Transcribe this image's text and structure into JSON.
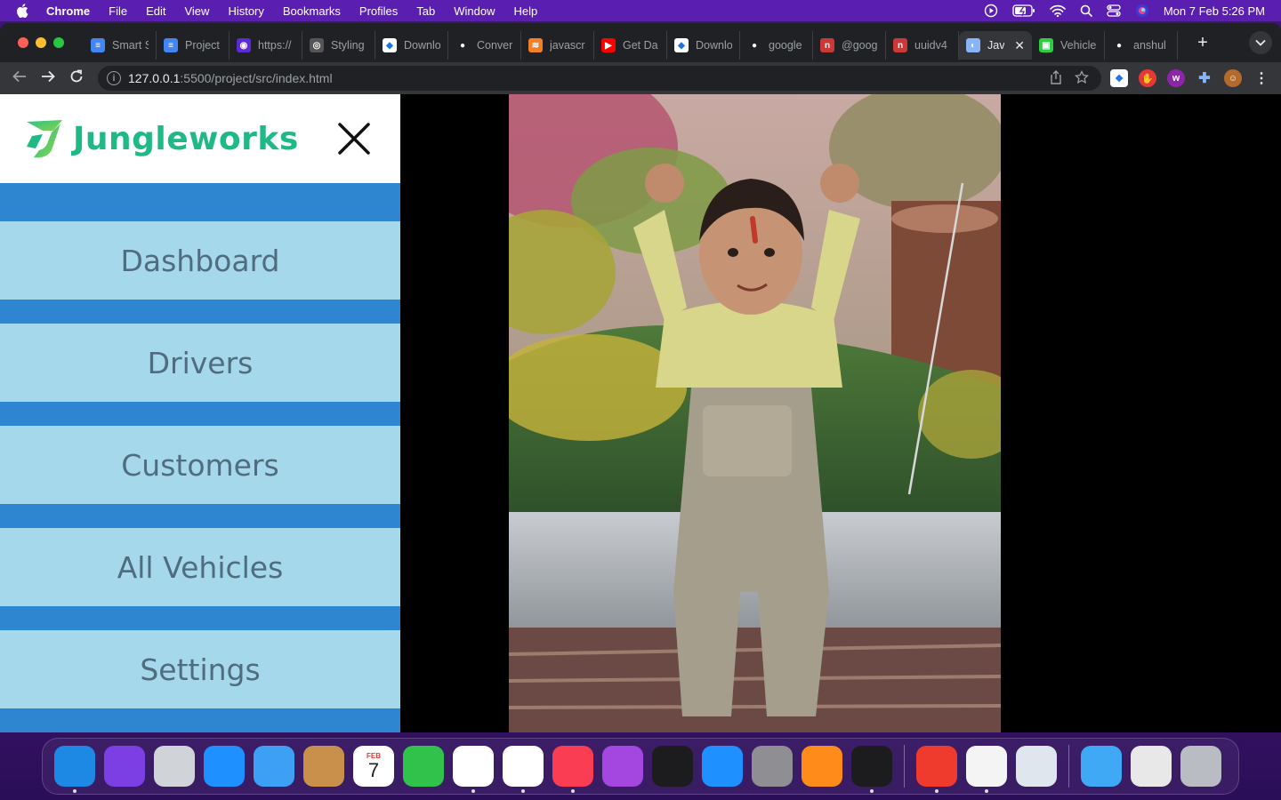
{
  "menubar": {
    "app": "Chrome",
    "items": [
      "File",
      "Edit",
      "View",
      "History",
      "Bookmarks",
      "Profiles",
      "Tab",
      "Window",
      "Help"
    ],
    "clock": "Mon 7 Feb  5:26 PM"
  },
  "tabs": [
    {
      "label": "Smart S",
      "color": "#4285f4",
      "glyph": "≡"
    },
    {
      "label": "Project",
      "color": "#4285f4",
      "glyph": "≡"
    },
    {
      "label": "https://",
      "color": "#5b2bd6",
      "glyph": "◉"
    },
    {
      "label": "Styling",
      "color": "#555555",
      "glyph": "◎"
    },
    {
      "label": "Downlo",
      "color": "#ffffff",
      "glyph": "◆"
    },
    {
      "label": "Conver",
      "color": "#202124",
      "glyph": "●"
    },
    {
      "label": "javascr",
      "color": "#f48024",
      "glyph": "≋"
    },
    {
      "label": "Get Da",
      "color": "#ff0000",
      "glyph": "▶"
    },
    {
      "label": "Downlo",
      "color": "#ffffff",
      "glyph": "◆"
    },
    {
      "label": "google",
      "color": "#202124",
      "glyph": "●"
    },
    {
      "label": "@goog",
      "color": "#cb3837",
      "glyph": "n"
    },
    {
      "label": "uuidv4",
      "color": "#cb3837",
      "glyph": "n"
    },
    {
      "label": "Jav",
      "color": "#8ab4f8",
      "glyph": "◐",
      "active": true
    },
    {
      "label": "Vehicle",
      "color": "#2ecc40",
      "glyph": "▣"
    },
    {
      "label": "anshul",
      "color": "#202124",
      "glyph": "●"
    }
  ],
  "address": {
    "host": "127.0.0.1",
    "path": ":5500/project/src/index.html"
  },
  "sidebar": {
    "brand": "Jungleworks",
    "items": [
      "Dashboard",
      "Drivers",
      "Customers",
      "All Vehicles",
      "Settings"
    ]
  },
  "colors": {
    "brand": "#1fb985",
    "sidebar_bg": "#2e86d1",
    "nav_item_bg": "#a5d8ea",
    "nav_text": "#4f6d7e"
  },
  "dock": [
    {
      "name": "finder-icon",
      "color": "#1e88e5",
      "dot": true
    },
    {
      "name": "siri-icon",
      "color": "#7b3fe4",
      "dot": false
    },
    {
      "name": "launchpad-icon",
      "color": "#d0d3d8",
      "dot": false
    },
    {
      "name": "safari-icon",
      "color": "#1e90ff",
      "dot": false
    },
    {
      "name": "mail-icon",
      "color": "#3da0f5",
      "dot": false
    },
    {
      "name": "contacts-icon",
      "color": "#c8904a",
      "dot": false
    },
    {
      "name": "calendar-icon",
      "color": "#ffffff",
      "dot": false
    },
    {
      "name": "facetime-icon",
      "color": "#30c24b",
      "dot": false
    },
    {
      "name": "chrome-icon",
      "color": "#ffffff",
      "dot": true
    },
    {
      "name": "vscode-icon",
      "color": "#ffffff",
      "dot": true
    },
    {
      "name": "music-icon",
      "color": "#fa3d52",
      "dot": true
    },
    {
      "name": "podcasts-icon",
      "color": "#a347e0",
      "dot": false
    },
    {
      "name": "appletv-icon",
      "color": "#1c1c1e",
      "dot": false
    },
    {
      "name": "appstore-icon",
      "color": "#1e90ff",
      "dot": false
    },
    {
      "name": "system-preferences-icon",
      "color": "#8e8e93",
      "dot": false
    },
    {
      "name": "pages-icon",
      "color": "#ff8c1a",
      "dot": false
    },
    {
      "name": "terminal-icon",
      "color": "#1c1c1e",
      "dot": true
    },
    {
      "name": "anydesk-icon",
      "color": "#ef3b2d",
      "dot": true
    },
    {
      "name": "document-icon",
      "color": "#f4f4f4",
      "dot": true
    },
    {
      "name": "preview-icon",
      "color": "#dfe6ee",
      "dot": false
    },
    {
      "name": "applications-folder-icon",
      "color": "#3fa9f5",
      "dot": false
    },
    {
      "name": "photo-file-icon",
      "color": "#e8e8e8",
      "dot": false
    },
    {
      "name": "trash-icon",
      "color": "#b9bcc2",
      "dot": false
    }
  ],
  "calendar": {
    "month": "FEB",
    "day": "7"
  }
}
